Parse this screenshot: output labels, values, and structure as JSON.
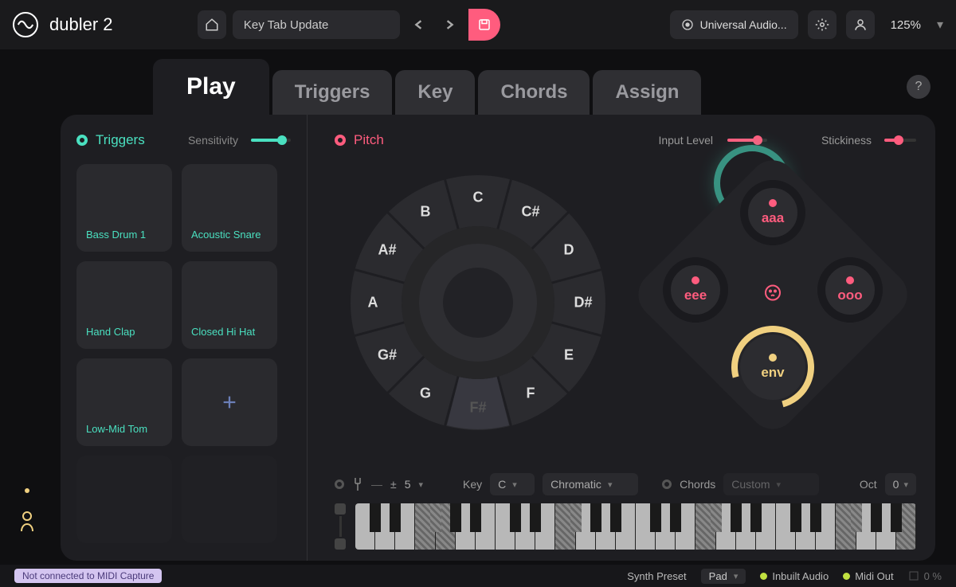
{
  "app": {
    "title": "dubler 2"
  },
  "header": {
    "document_title": "Key Tab Update",
    "audio_device": "Universal Audio...",
    "zoom": "125%"
  },
  "tabs": [
    "Play",
    "Triggers",
    "Key",
    "Chords",
    "Assign"
  ],
  "active_tab": "Play",
  "triggers": {
    "label": "Triggers",
    "sensitivity_label": "Sensitivity",
    "pads": [
      "Bass Drum 1",
      "Acoustic Snare",
      "Hand Clap",
      "Closed Hi Hat",
      "Low-Mid Tom"
    ]
  },
  "pitch": {
    "label": "Pitch",
    "input_level_label": "Input Level",
    "stickiness_label": "Stickiness",
    "notes": [
      "C",
      "C#",
      "D",
      "D#",
      "E",
      "F",
      "F#",
      "G",
      "G#",
      "A",
      "A#",
      "B"
    ],
    "muted_note": "F#"
  },
  "vowels": {
    "top": "aaa",
    "left": "eee",
    "right": "ooo",
    "bottom": "env"
  },
  "key_controls": {
    "transpose_label": "±",
    "transpose_value": "5",
    "key_label": "Key",
    "key_value": "C",
    "scale": "Chromatic",
    "chords_label": "Chords",
    "chords_preset": "Custom",
    "oct_label": "Oct",
    "oct_value": "0"
  },
  "status": {
    "midi_capture": "Not connected to MIDI Capture",
    "synth_preset_label": "Synth Preset",
    "synth_preset_value": "Pad",
    "inbuilt_audio": "Inbuilt Audio",
    "midi_out": "Midi Out",
    "cpu": "0 %"
  }
}
